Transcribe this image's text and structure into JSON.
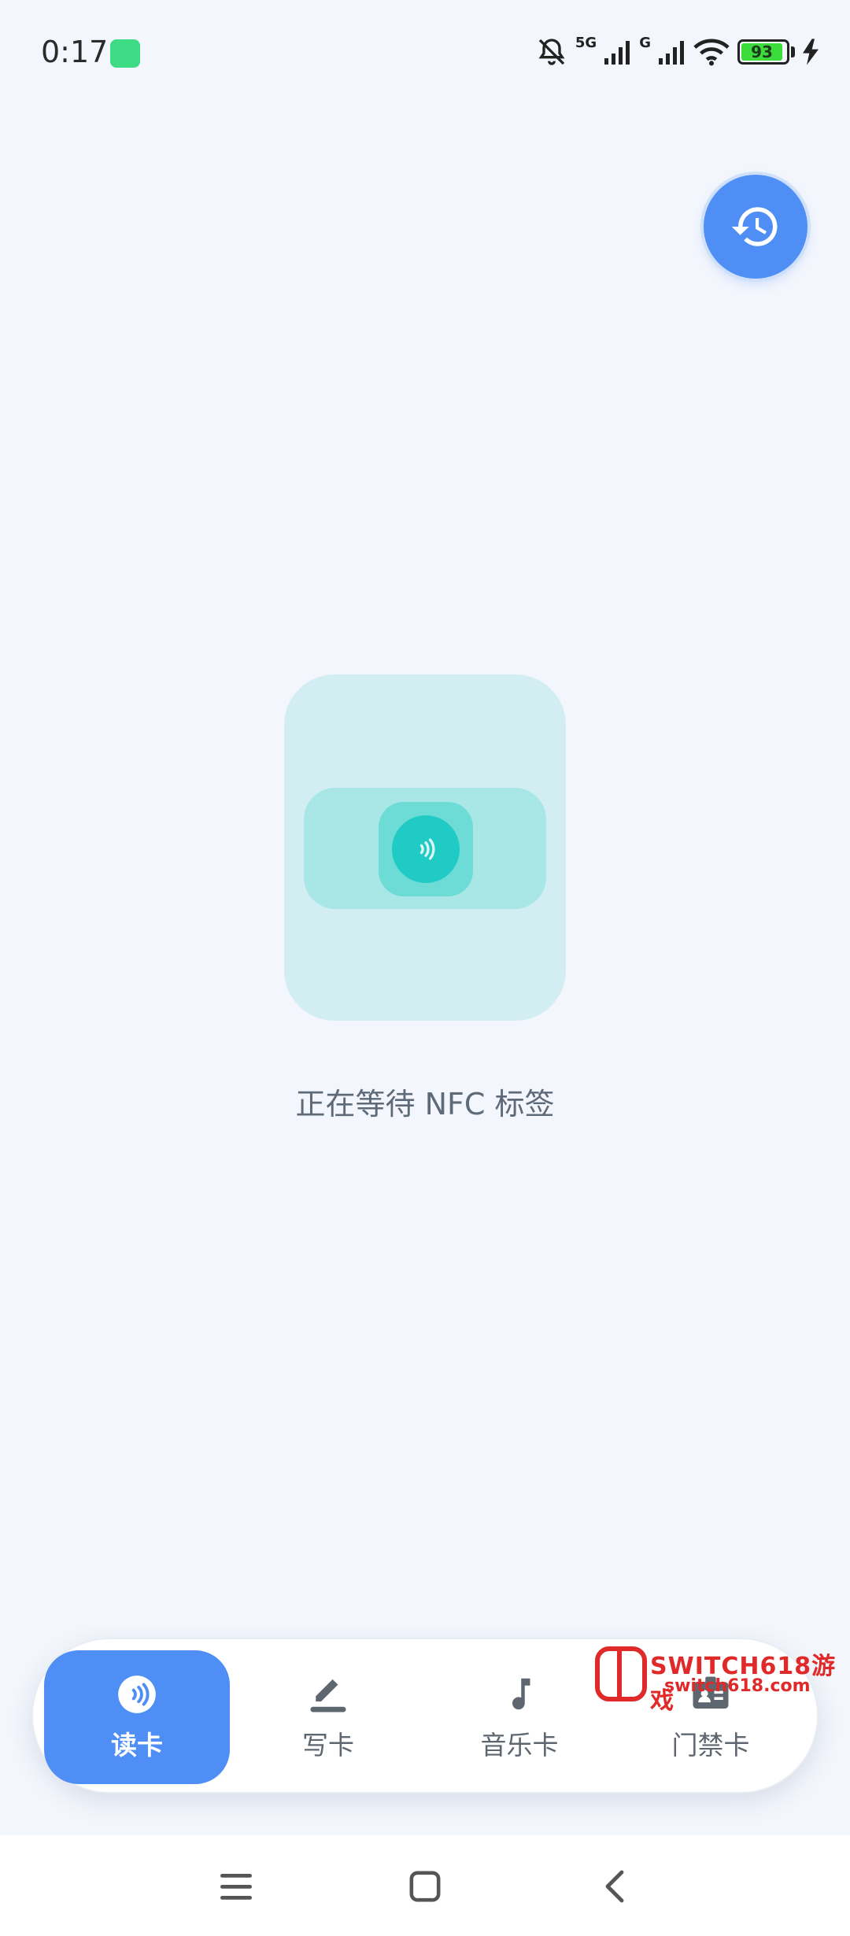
{
  "status_bar": {
    "time": "0:17",
    "network_5g": "5G",
    "network_g": "G",
    "battery_level": "93",
    "icons": [
      "android-icon",
      "mute-bell-icon",
      "signal-icon",
      "wifi-icon",
      "battery-icon",
      "charging-icon"
    ]
  },
  "history_button": {
    "icon": "history-icon"
  },
  "main": {
    "waiting_text": "正在等待 NFC 标签"
  },
  "tabs": [
    {
      "label": "读卡",
      "icon": "nfc-icon",
      "active": true
    },
    {
      "label": "写卡",
      "icon": "pen-icon",
      "active": false
    },
    {
      "label": "音乐卡",
      "icon": "music-note-icon",
      "active": false
    },
    {
      "label": "门禁卡",
      "icon": "badge-icon",
      "active": false
    }
  ],
  "watermark": {
    "line1": "SWITCH618游戏",
    "line2": "switch618.com"
  },
  "nav": {
    "icons": [
      "menu-icon",
      "home-icon",
      "back-icon"
    ]
  },
  "colors": {
    "accent": "#4e8ef5",
    "nfc_teal": "#20cbc5",
    "background": "#f3f6fc"
  }
}
